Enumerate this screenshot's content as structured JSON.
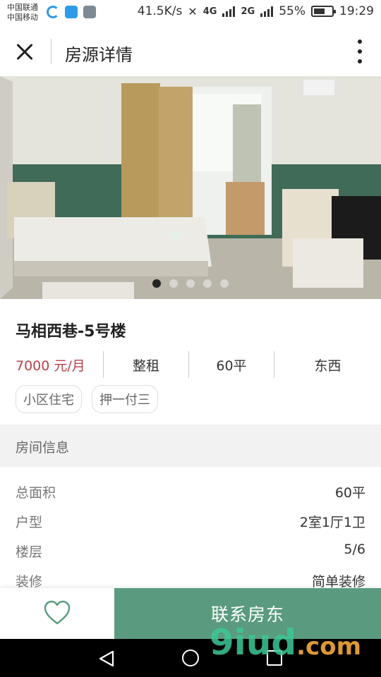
{
  "status_bar": {
    "carrier_1": "中国联通",
    "carrier_2": "中国移动",
    "net_speed": "41.5K/s",
    "network_1": "4G",
    "network_2": "2G",
    "battery": "55%",
    "time": "19:29"
  },
  "header": {
    "title": "房源详情",
    "close_icon": "close-icon",
    "more_icon": "more-vertical-icon"
  },
  "gallery": {
    "image_count": 5,
    "active_index": 0
  },
  "listing": {
    "title": "马相西巷-5号楼",
    "price": "7000 元/月",
    "rent_type": "整租",
    "area": "60平",
    "orientation": "东西",
    "tags": [
      "小区住宅",
      "押一付三"
    ]
  },
  "room_info": {
    "section_title": "房间信息",
    "rows": [
      {
        "label": "总面积",
        "value": "60平"
      },
      {
        "label": "户型",
        "value": "2室1厅1卫"
      },
      {
        "label": "楼层",
        "value": "5/6"
      },
      {
        "label": "装修",
        "value": "简单装修"
      }
    ]
  },
  "actions": {
    "favorite_icon": "heart-icon",
    "contact_label": "联系房东"
  },
  "watermark": {
    "logo": "9iud",
    "tld": ".com"
  },
  "colors": {
    "price": "#b5424a",
    "primary_button": "#5a9b80",
    "section_bg": "#f2f2f2"
  }
}
